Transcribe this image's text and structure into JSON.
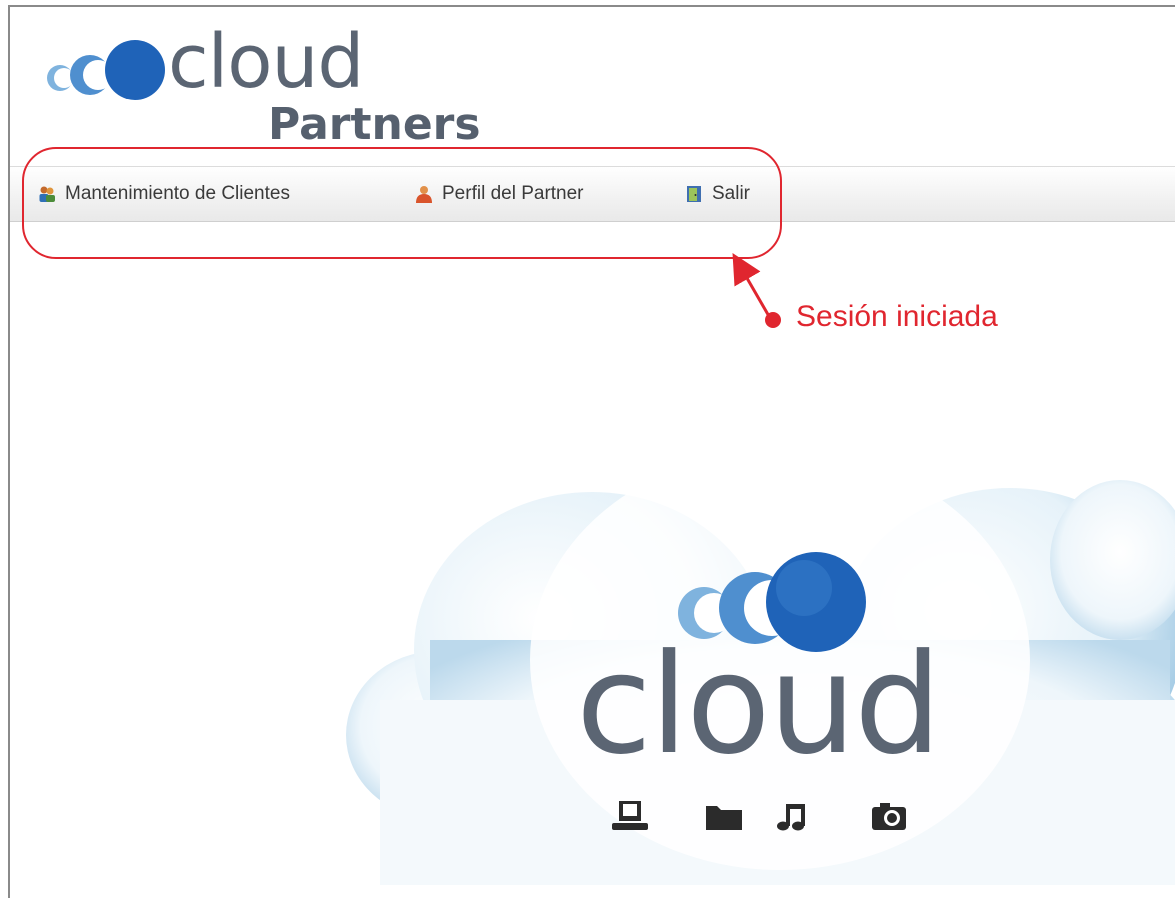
{
  "header": {
    "logo_word": "cloud",
    "logo_sub": "Partners"
  },
  "nav": {
    "items": [
      {
        "label": "Mantenimiento de Clientes",
        "icon": "users-icon"
      },
      {
        "label": "Perfil del Partner",
        "icon": "user-profile-icon"
      },
      {
        "label": "Salir",
        "icon": "exit-door-icon"
      }
    ]
  },
  "annotation": {
    "label": "Sesión iniciada",
    "color": "#e0262f"
  },
  "hero": {
    "logo_word": "cloud",
    "icons": [
      "laptop-icon",
      "folder-icon",
      "music-icon",
      "camera-icon"
    ]
  },
  "colors": {
    "brand_blue": "#1f63b8",
    "brand_light_blue": "#7fb3de",
    "logo_text": "#5b6573",
    "annotation_red": "#e0262f"
  }
}
